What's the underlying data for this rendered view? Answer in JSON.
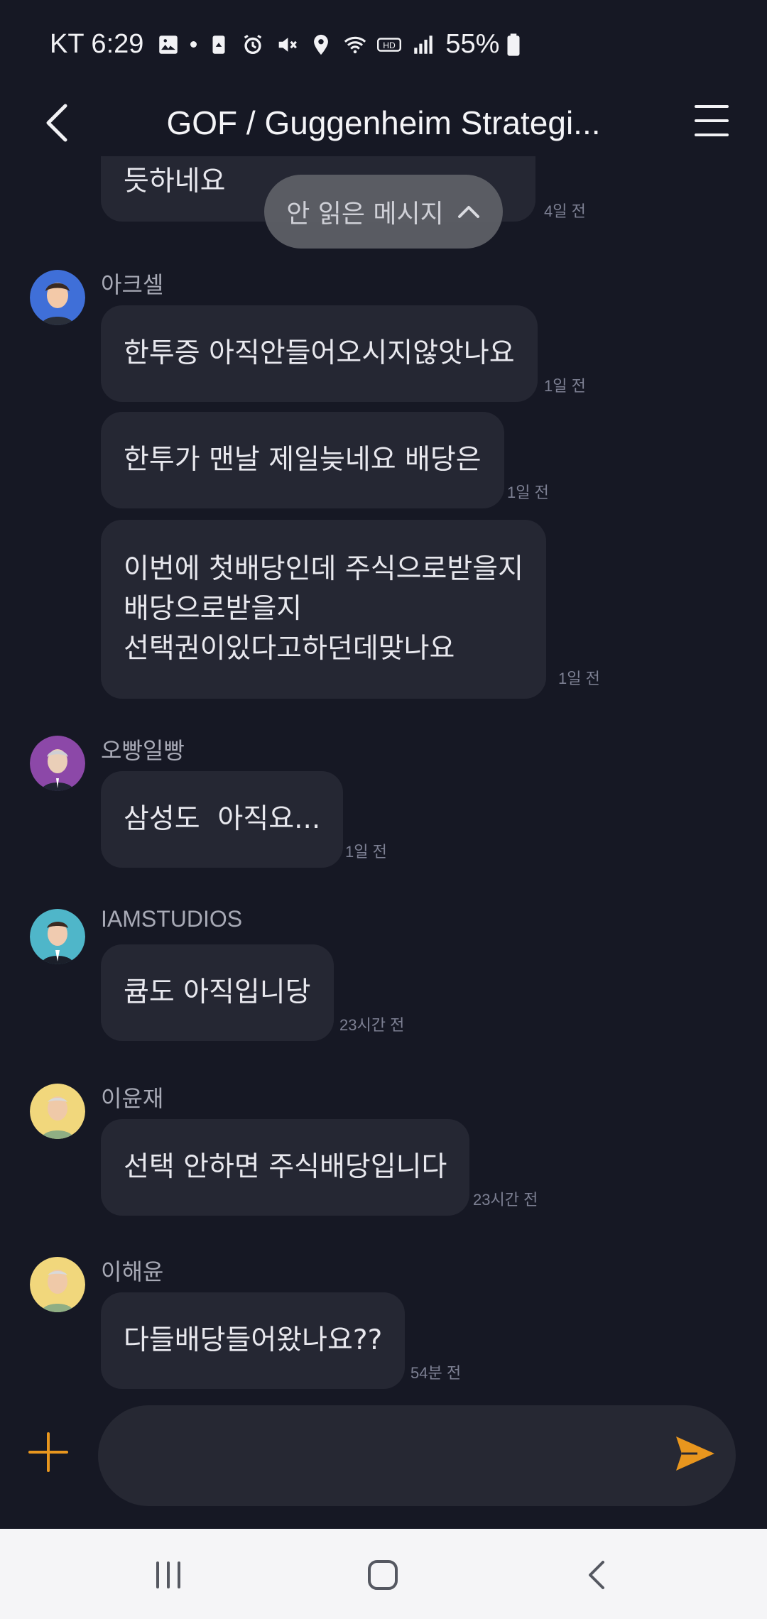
{
  "status_bar": {
    "carrier_time": "KT 6:29",
    "battery": "55%",
    "icons": [
      "image-icon",
      "dot-icon",
      "recycle-icon",
      "alarm-icon",
      "mute-icon",
      "location-icon",
      "wifi-icon",
      "hd-icon",
      "signal-icon",
      "battery-icon"
    ]
  },
  "header": {
    "title": "GOF / Guggenheim Strategi...",
    "back_icon": "chevron-left-icon",
    "menu_icon": "hamburger-menu-icon"
  },
  "unread": {
    "label": "안 읽은 메시지"
  },
  "messages": {
    "m0": {
      "text": "듯하네요",
      "time": "4일 전"
    },
    "m1": {
      "sender": "아크셀",
      "text": "한투증 아직안들어오시지않앗나요",
      "time": "1일 전"
    },
    "m2": {
      "text": "한투가 맨날 제일늦네요 배당은",
      "time": "1일 전"
    },
    "m3": {
      "lines": [
        "이번에 첫배당인데 주식으로받을지",
        "배당으로받을지",
        "선택권이있다고하던데맞나요"
      ],
      "time": "1일 전"
    },
    "m4": {
      "sender": "오빵일빵",
      "text": "삼성도  아직요...",
      "time": "1일 전"
    },
    "m5": {
      "sender": "IAMSTUDIOS",
      "text": "큠도 아직입니당",
      "time": "23시간 전"
    },
    "m6": {
      "sender": "이윤재",
      "text": "선택 안하면 주식배당입니다",
      "time": "23시간 전"
    },
    "m7": {
      "sender": "이해윤",
      "text": "다들배당들어왔나요??",
      "time": "54분 전"
    }
  },
  "composer": {
    "value": "",
    "placeholder": ""
  },
  "colors": {
    "background": "#161824",
    "bubble": "#252733",
    "accent": "#e8961e"
  }
}
